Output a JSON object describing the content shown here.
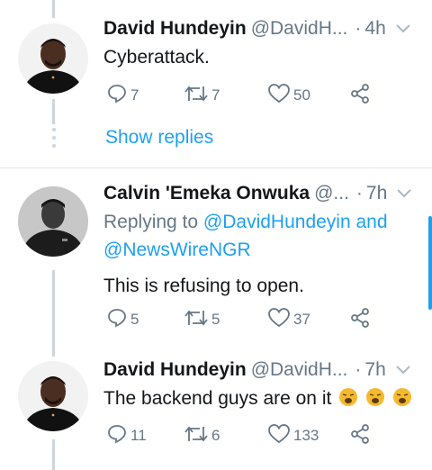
{
  "tweets": [
    {
      "name": "David Hundeyin",
      "handle": "@DavidH...",
      "separator": "·",
      "time": "4h",
      "text": "Cyberattack.",
      "replies": "7",
      "retweets": "7",
      "likes": "50"
    },
    {
      "name": "Calvin 'Emeka Onwuka",
      "handle": "@...",
      "separator": "·",
      "time": "7h",
      "replying_prefix": "Replying to ",
      "replying_to": "@DavidHundeyin and",
      "replying_to_2": "@NewsWireNGR",
      "text": "This is refusing to open.",
      "replies": "5",
      "retweets": "5",
      "likes": "37"
    },
    {
      "name": "David Hundeyin",
      "handle": "@DavidH...",
      "separator": "·",
      "time": "7h",
      "text": "The backend guys are on it",
      "emoji": "weary-face-x3",
      "replies": "11",
      "retweets": "6",
      "likes": "133"
    }
  ],
  "show_replies_label": "Show replies",
  "colors": {
    "accent": "#1da1f2",
    "muted": "#657786",
    "text": "#14171a",
    "thread_line": "#ccd6dd"
  }
}
